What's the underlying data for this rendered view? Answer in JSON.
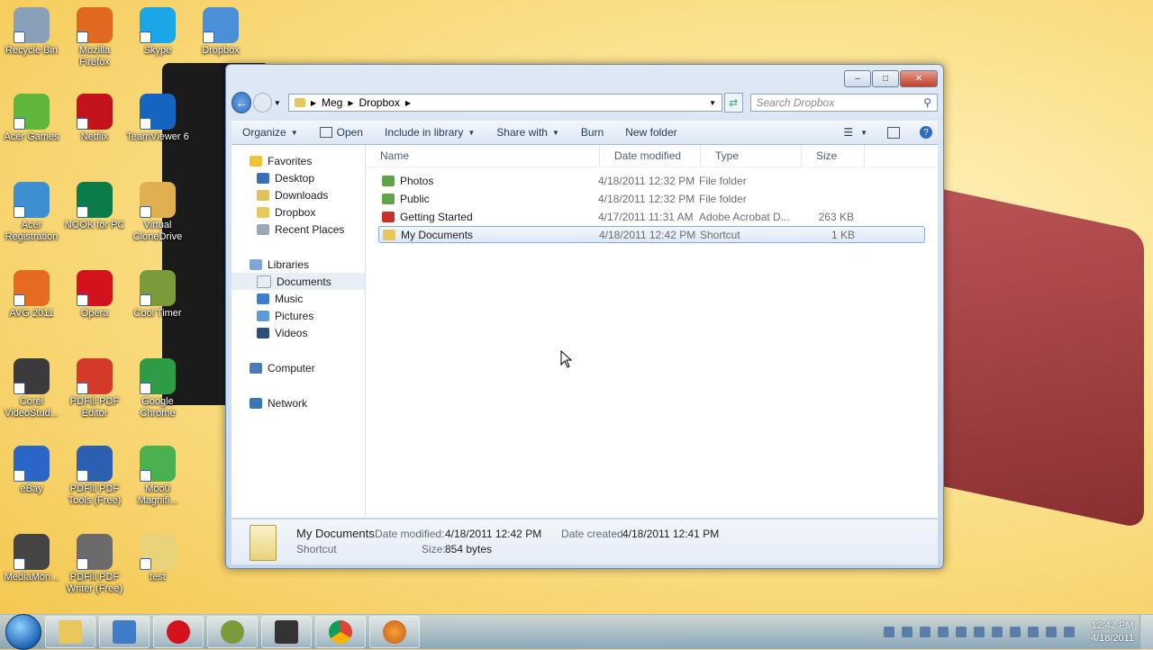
{
  "desktop": {
    "icons": [
      {
        "label": "Recycle Bin",
        "color": "#8aa0b8"
      },
      {
        "label": "Mozilla Firefox",
        "color": "#e0681f"
      },
      {
        "label": "Skype",
        "color": "#1aa6e8"
      },
      {
        "label": "Dropbox",
        "color": "#4a90d9"
      },
      {
        "label": "Acer Games",
        "color": "#5fb63a"
      },
      {
        "label": "Netflix",
        "color": "#c4141b"
      },
      {
        "label": "TeamViewer 6",
        "color": "#1565c0"
      },
      {
        "label": "Acer Registration",
        "color": "#3d8fd1"
      },
      {
        "label": "NOOK for PC",
        "color": "#0c7b4a"
      },
      {
        "label": "Virtual CloneDrive",
        "color": "#e0b050"
      },
      {
        "label": "AVG 2011",
        "color": "#e56b20"
      },
      {
        "label": "Opera",
        "color": "#d4121e"
      },
      {
        "label": "Cool Timer",
        "color": "#7a9b3a"
      },
      {
        "label": "Corel VideoStud...",
        "color": "#3b3b3b"
      },
      {
        "label": "PDFill PDF Editor",
        "color": "#d33a2a"
      },
      {
        "label": "Google Chrome",
        "color": "#2e9b45"
      },
      {
        "label": "eBay",
        "color": "#2b66c6"
      },
      {
        "label": "PDFill PDF Tools (Free)",
        "color": "#2b5fb0"
      },
      {
        "label": "Moo0 Magnifi...",
        "color": "#4bb04f"
      },
      {
        "label": "MediaMon...",
        "color": "#444444"
      },
      {
        "label": "PDFill PDF Writer (Free)",
        "color": "#6b6b6b"
      },
      {
        "label": "test",
        "color": "#e8d27a"
      }
    ]
  },
  "window": {
    "address": {
      "parts": [
        "Meg",
        "Dropbox"
      ]
    },
    "search": {
      "placeholder": "Search Dropbox"
    },
    "toolbar": {
      "organize": "Organize",
      "open": "Open",
      "include": "Include in library",
      "share": "Share with",
      "burn": "Burn",
      "newfolder": "New folder"
    },
    "nav": {
      "favorites": "Favorites",
      "desktop": "Desktop",
      "downloads": "Downloads",
      "dropbox": "Dropbox",
      "recent": "Recent Places",
      "libraries": "Libraries",
      "documents": "Documents",
      "music": "Music",
      "pictures": "Pictures",
      "videos": "Videos",
      "computer": "Computer",
      "network": "Network"
    },
    "columns": {
      "name": "Name",
      "date": "Date modified",
      "type": "Type",
      "size": "Size"
    },
    "files": [
      {
        "name": "Photos",
        "date": "4/18/2011 12:32 PM",
        "type": "File folder",
        "size": ""
      },
      {
        "name": "Public",
        "date": "4/18/2011 12:32 PM",
        "type": "File folder",
        "size": ""
      },
      {
        "name": "Getting Started",
        "date": "4/17/2011 11:31 AM",
        "type": "Adobe Acrobat D...",
        "size": "263 KB"
      },
      {
        "name": "My Documents",
        "date": "4/18/2011 12:42 PM",
        "type": "Shortcut",
        "size": "1 KB"
      }
    ],
    "details": {
      "name": "My Documents",
      "kind": "Shortcut",
      "modified_label": "Date modified:",
      "modified": "4/18/2011 12:42 PM",
      "created_label": "Date created:",
      "created": "4/18/2011 12:41 PM",
      "size_label": "Size:",
      "size": "854 bytes"
    }
  },
  "taskbar": {
    "clock_time": "12:42 PM",
    "clock_date": "4/18/2011"
  }
}
